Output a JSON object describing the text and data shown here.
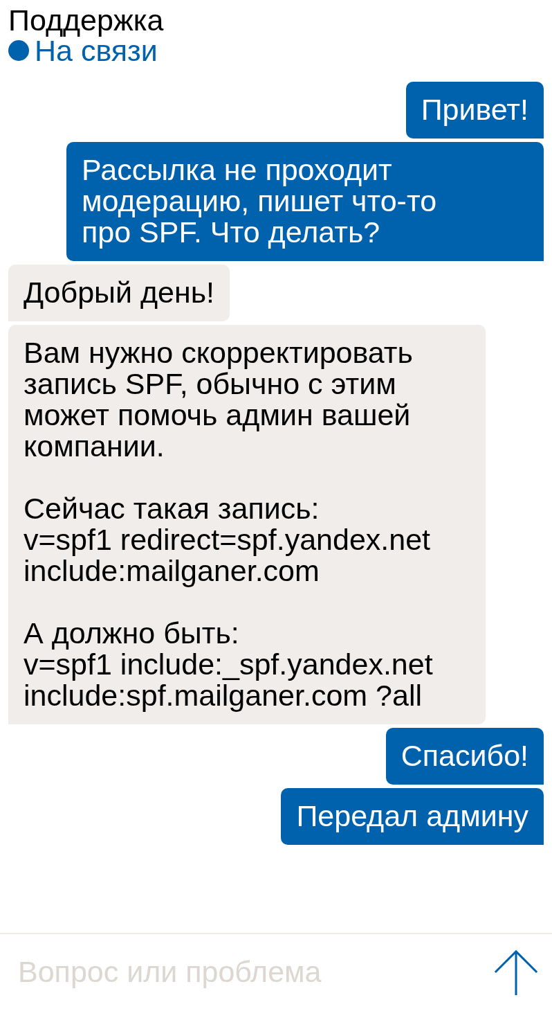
{
  "header": {
    "title": "Поддержка",
    "status": {
      "label": "На связи",
      "online": true
    }
  },
  "messages": [
    {
      "kind": "outgoing",
      "text": "Привет!"
    },
    {
      "kind": "outgoing",
      "text": "Рассылка не проходит модерацию, пишет что-то\nпро SPF. Что делать?"
    },
    {
      "kind": "incoming",
      "text": "Добрый день!"
    },
    {
      "kind": "incoming",
      "text": "Вам нужно скорректировать запись SPF, обычно с этим может помочь админ вашей компании.\n\nСейчас такая запись:\nv=spf1 redirect=spf.yandex.net include:mailganer.com\n\nА должно быть:\nv=spf1 include:_spf.yandex.net include:spf.mailganer.com ?all"
    },
    {
      "kind": "outgoing",
      "text": "Спасибо!"
    },
    {
      "kind": "outgoing",
      "text": "Передал админу"
    }
  ],
  "composer": {
    "placeholder": "Вопрос или проблема"
  }
}
